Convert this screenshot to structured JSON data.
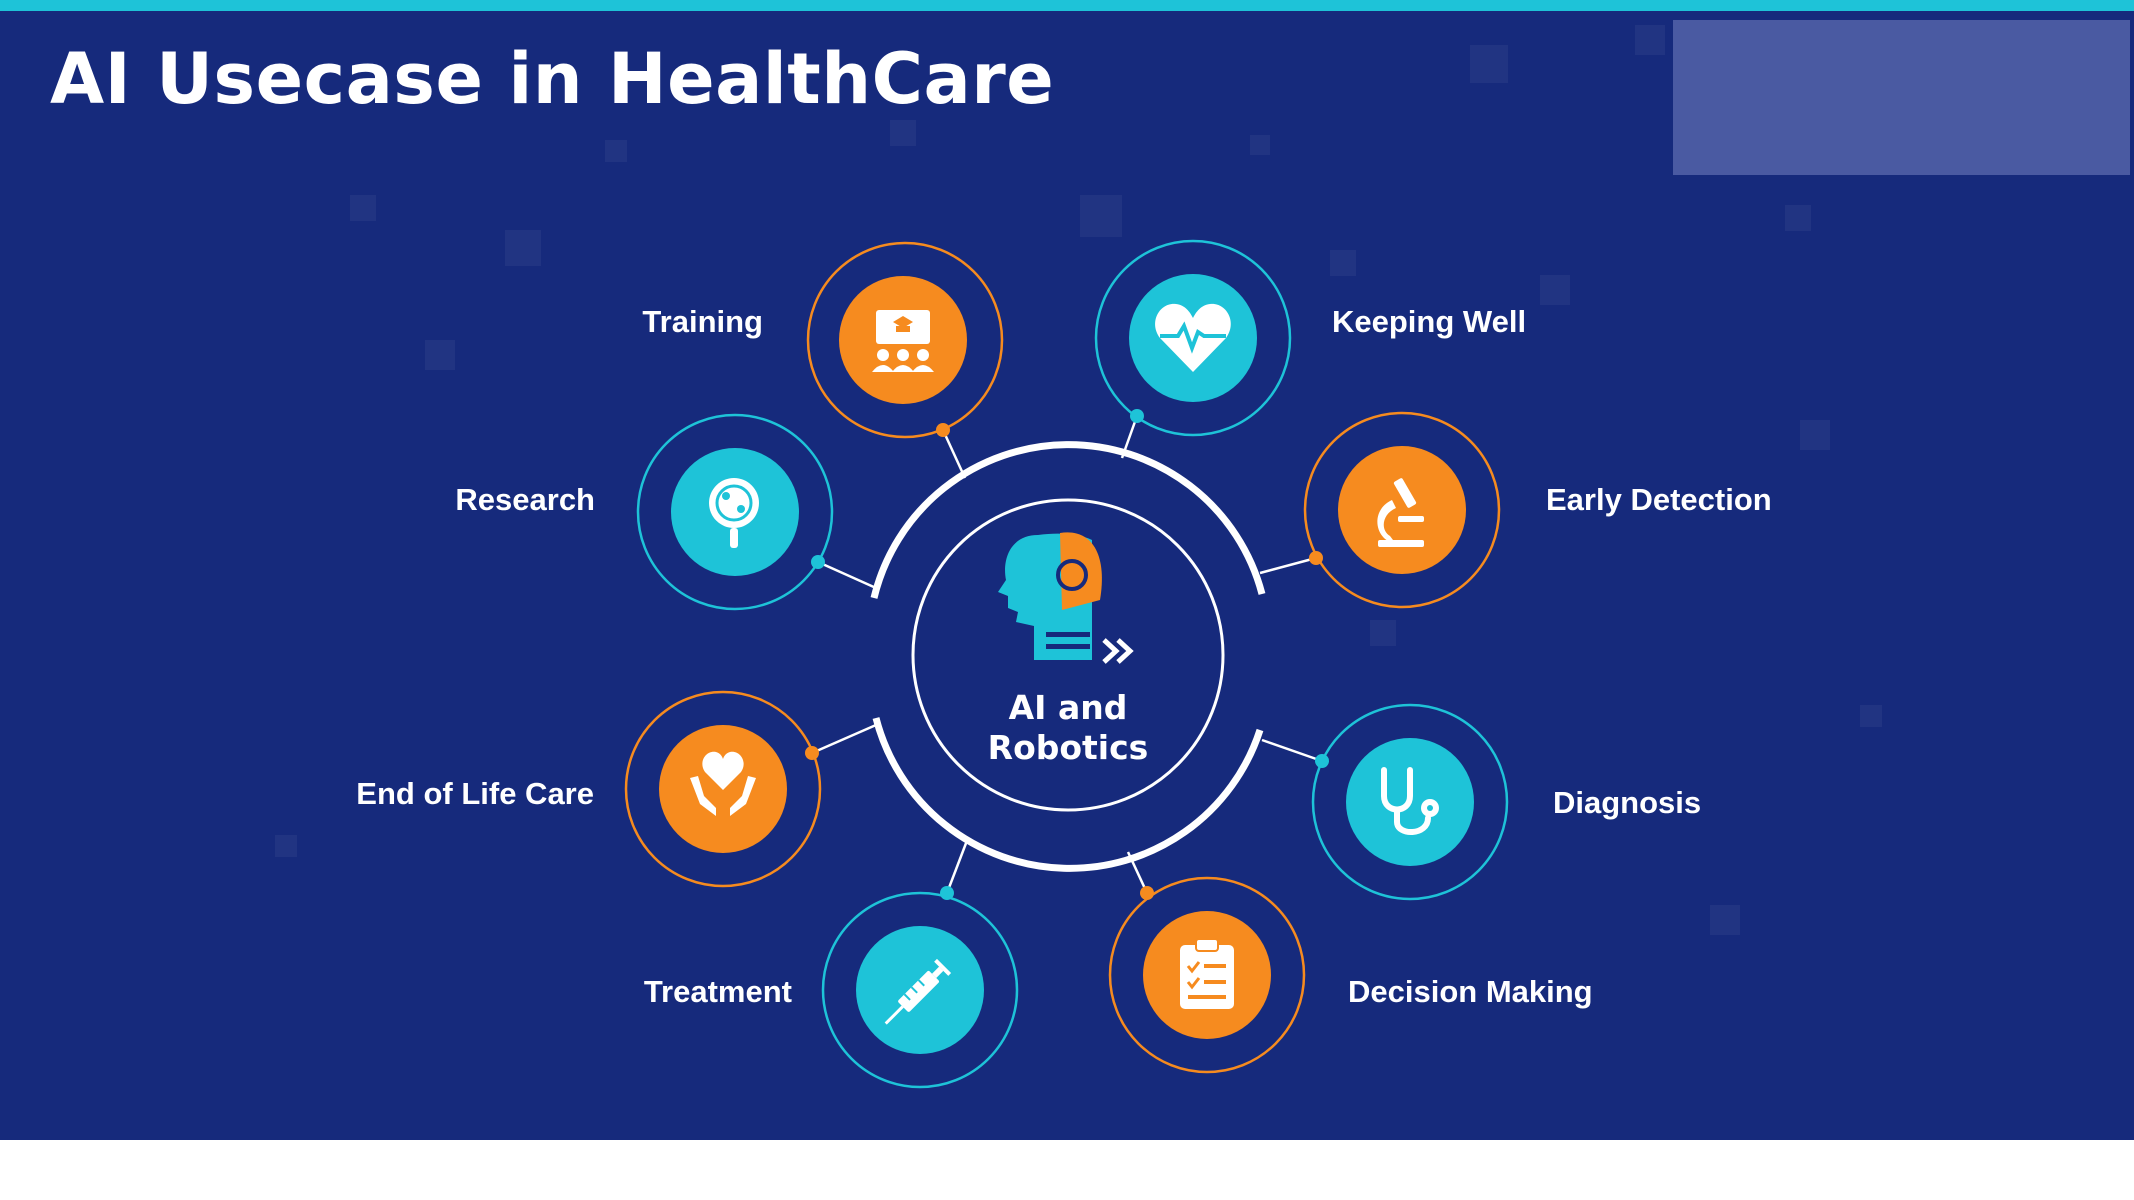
{
  "title": "AI Usecase in HealthCare",
  "center": {
    "line1": "AI and",
    "line2": "Robotics",
    "icon": "ai-robot-head-icon"
  },
  "colors": {
    "background": "#162a7c",
    "accent_teal": "#1ec3d8",
    "accent_orange": "#f68b1f",
    "text": "#ffffff"
  },
  "items": [
    {
      "label": "Training",
      "icon": "training-presentation-icon",
      "color": "orange"
    },
    {
      "label": "Keeping Well",
      "icon": "heartbeat-icon",
      "color": "teal"
    },
    {
      "label": "Research",
      "icon": "research-magnifier-icon",
      "color": "teal"
    },
    {
      "label": "Early Detection",
      "icon": "microscope-icon",
      "color": "orange"
    },
    {
      "label": "End of Life Care",
      "icon": "caring-hands-heart-icon",
      "color": "orange"
    },
    {
      "label": "Diagnosis",
      "icon": "stethoscope-icon",
      "color": "teal"
    },
    {
      "label": "Treatment",
      "icon": "syringe-icon",
      "color": "teal"
    },
    {
      "label": "Decision Making",
      "icon": "clipboard-checklist-icon",
      "color": "orange"
    }
  ]
}
